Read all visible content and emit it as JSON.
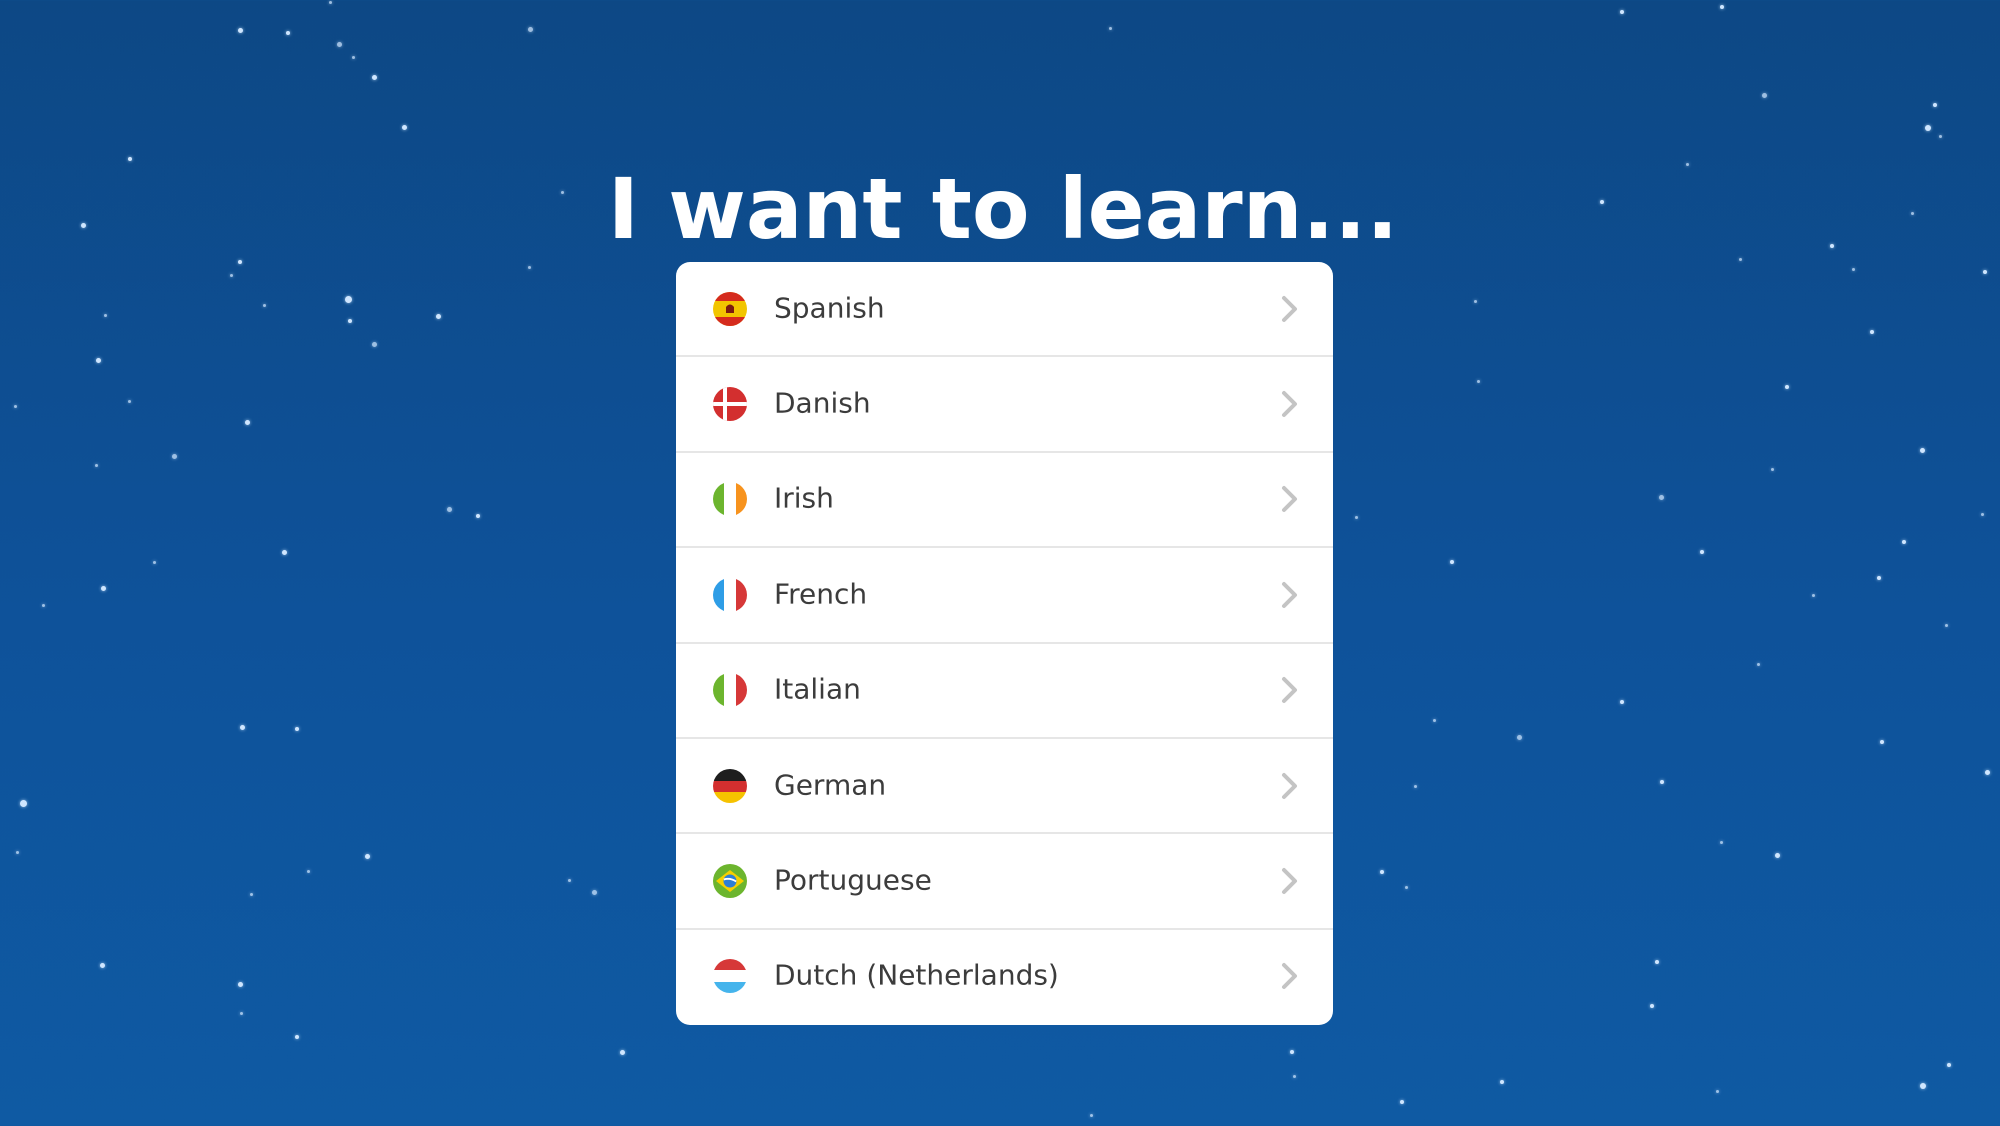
{
  "page": {
    "title": "I want to learn..."
  },
  "languages": [
    {
      "label": "Spanish",
      "flag": "spain-flag-icon"
    },
    {
      "label": "Danish",
      "flag": "denmark-flag-icon"
    },
    {
      "label": "Irish",
      "flag": "ireland-flag-icon"
    },
    {
      "label": "French",
      "flag": "france-flag-icon"
    },
    {
      "label": "Italian",
      "flag": "italy-flag-icon"
    },
    {
      "label": "German",
      "flag": "germany-flag-icon"
    },
    {
      "label": "Portuguese",
      "flag": "brazil-flag-icon"
    },
    {
      "label": "Dutch (Netherlands)",
      "flag": "netherlands-flag-icon"
    }
  ],
  "row_action_icon": "chevron-right-icon",
  "colors": {
    "background_top": "#0d4885",
    "background_bottom": "#0f5aa3",
    "card": "#ffffff",
    "text": "#3c3c3c",
    "chevron": "#c4c4c4",
    "divider": "#e6e6e6"
  }
}
